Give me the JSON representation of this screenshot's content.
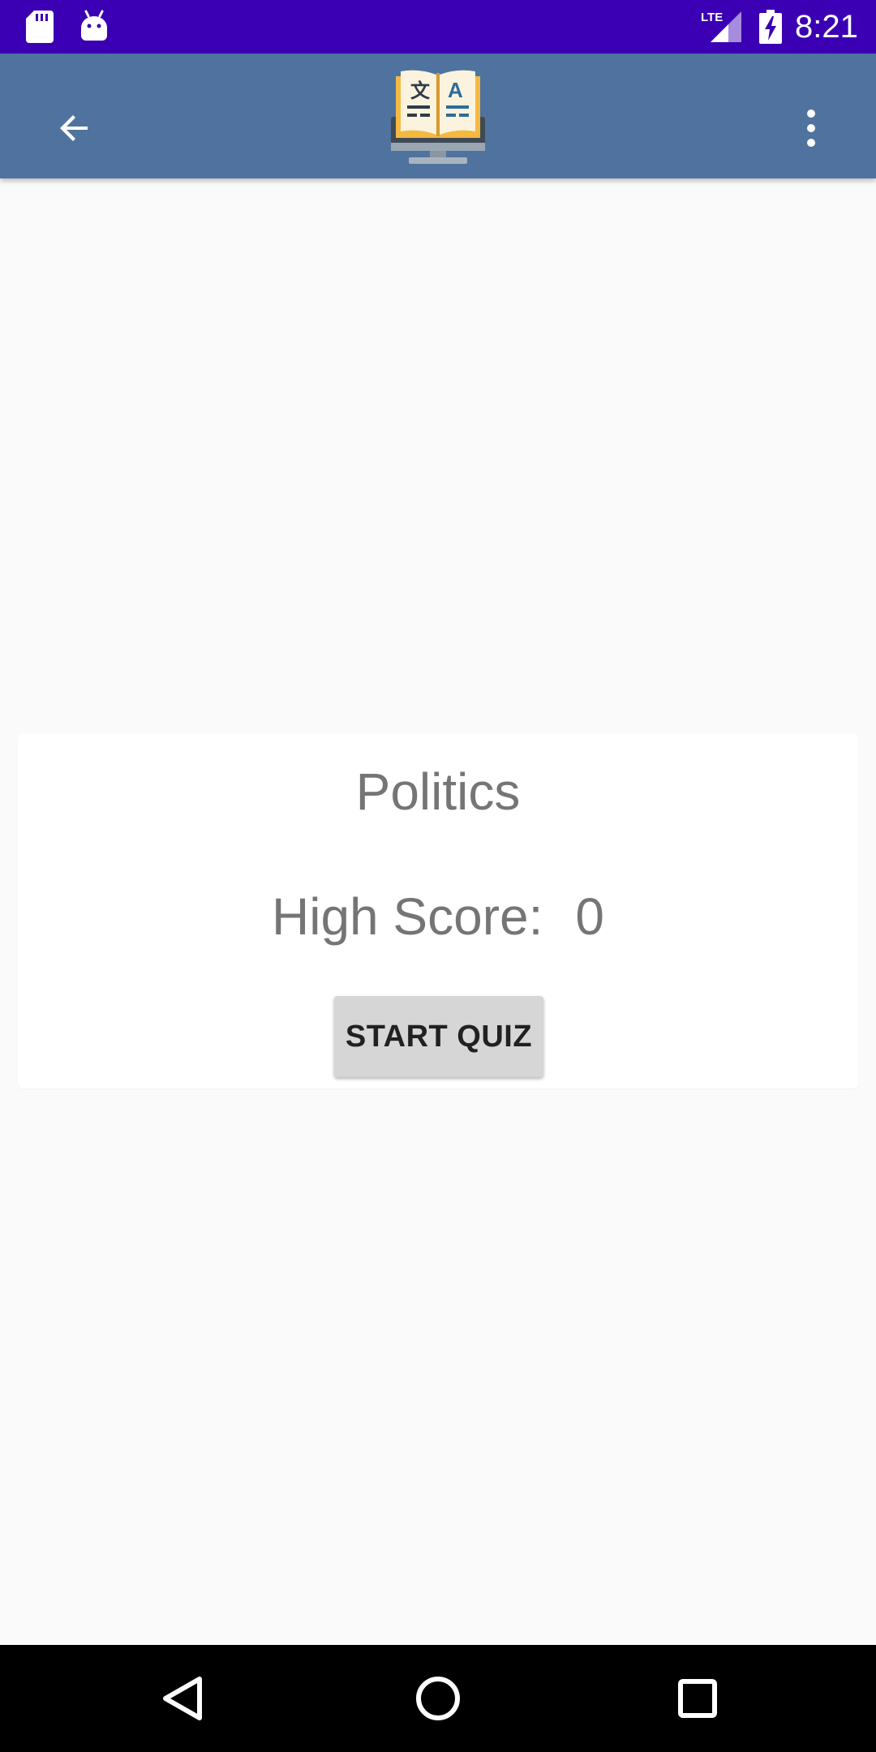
{
  "status_bar": {
    "time": "8:21",
    "network": "LTE",
    "icons": [
      "sd-card-icon",
      "android-icon",
      "lte-signal-icon",
      "battery-charging-icon"
    ]
  },
  "app_bar": {
    "back_icon": "arrow-back-icon",
    "logo_icon": "dictionary-monitor-icon",
    "overflow_icon": "more-vert-icon",
    "colors": {
      "background": "#4f739e",
      "status_bar": "#3b00b3"
    }
  },
  "quiz_card": {
    "title": "Politics",
    "high_score_label": "High Score:",
    "high_score_value": "0",
    "start_button_label": "START QUIZ"
  },
  "nav_bar": {
    "icons": [
      "nav-back-icon",
      "nav-home-icon",
      "nav-recents-icon"
    ]
  }
}
